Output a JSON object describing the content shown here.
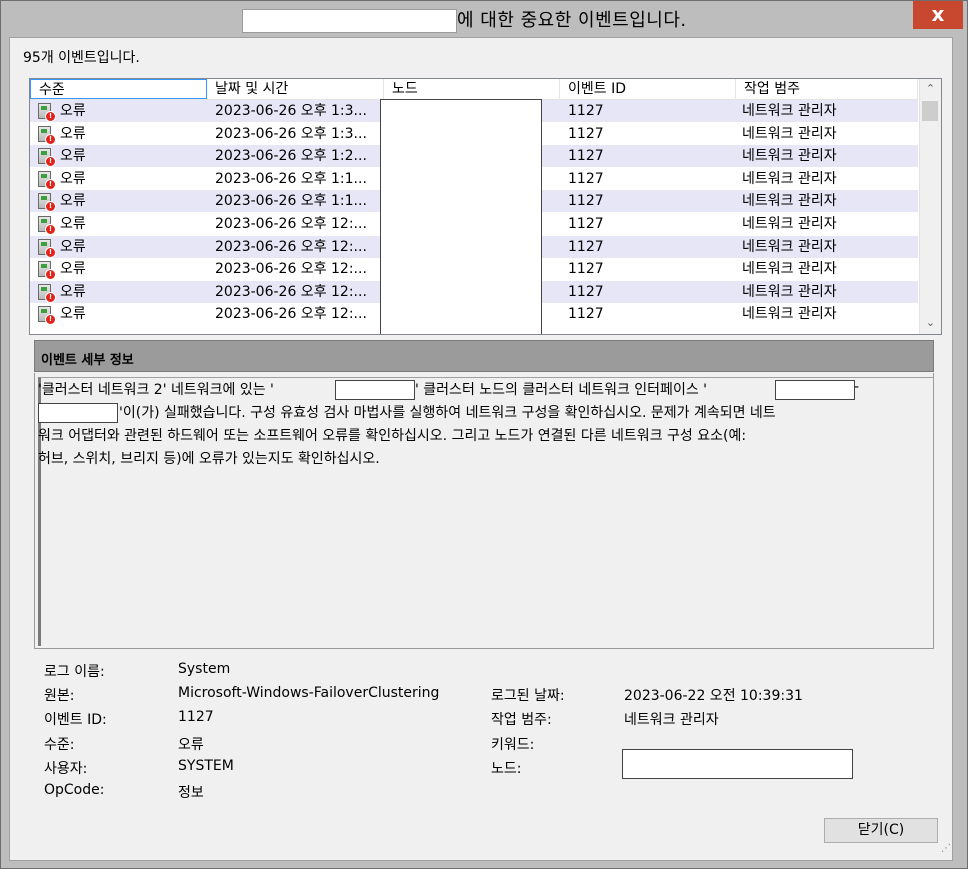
{
  "window": {
    "title_suffix": "에 대한 중요한 이벤트입니다.",
    "close_glyph": "x"
  },
  "summary": {
    "count_text": "95개 이벤트입니다."
  },
  "list": {
    "columns": [
      "수준",
      "날짜 및 시간",
      "노드",
      "이벤트 ID",
      "작업 범주"
    ],
    "rows": [
      {
        "level": "오류",
        "datetime": "2023-06-26 오후 1:3...",
        "event_id": "1127",
        "category": "네트워크 관리자"
      },
      {
        "level": "오류",
        "datetime": "2023-06-26 오후 1:3...",
        "event_id": "1127",
        "category": "네트워크 관리자"
      },
      {
        "level": "오류",
        "datetime": "2023-06-26 오후 1:2...",
        "event_id": "1127",
        "category": "네트워크 관리자"
      },
      {
        "level": "오류",
        "datetime": "2023-06-26 오후 1:1...",
        "event_id": "1127",
        "category": "네트워크 관리자"
      },
      {
        "level": "오류",
        "datetime": "2023-06-26 오후 1:1...",
        "event_id": "1127",
        "category": "네트워크 관리자"
      },
      {
        "level": "오류",
        "datetime": "2023-06-26 오후 12:...",
        "event_id": "1127",
        "category": "네트워크 관리자"
      },
      {
        "level": "오류",
        "datetime": "2023-06-26 오후 12:...",
        "event_id": "1127",
        "category": "네트워크 관리자"
      },
      {
        "level": "오류",
        "datetime": "2023-06-26 오후 12:...",
        "event_id": "1127",
        "category": "네트워크 관리자"
      },
      {
        "level": "오류",
        "datetime": "2023-06-26 오후 12:...",
        "event_id": "1127",
        "category": "네트워크 관리자"
      },
      {
        "level": "오류",
        "datetime": "2023-06-26 오후 12:...",
        "event_id": "1127",
        "category": "네트워크 관리자"
      }
    ]
  },
  "details": {
    "header": "이벤트 세부 정보",
    "line1_a": "'클러스터 네트워크 2' 네트워크에 있는 '",
    "line1_b": "' 클러스터 노드의 클러스터 네트워크 인터페이스 '",
    "line1_c": " -",
    "line2_a": "'이(가) 실패했습니다. 구성 유효성 검사 마법사를 실행하여 네트워크 구성을 확인하십시오. 문제가 계속되면 네트",
    "line3": "워크 어댑터와 관련된 하드웨어 또는 소프트웨어 오류를 확인하십시오. 그리고 노드가 연결된 다른 네트워크 구성 요소(예:",
    "line4": "허브, 스위치, 브리지 등)에 오류가 있는지도 확인하십시오."
  },
  "properties": {
    "log_name_label": "로그 이름:",
    "log_name_value": "System",
    "source_label": "원본:",
    "source_value": "Microsoft-Windows-FailoverClustering",
    "event_id_label": "이벤트 ID:",
    "event_id_value": "1127",
    "level_label": "수준:",
    "level_value": "오류",
    "user_label": "사용자:",
    "user_value": "SYSTEM",
    "opcode_label": "OpCode:",
    "opcode_value": "정보",
    "logged_label": "로그된 날짜:",
    "logged_value": "2023-06-22 오전 10:39:31",
    "category_label": "작업 범주:",
    "category_value": "네트워크 관리자",
    "keywords_label": "키워드:",
    "node_label": "노드:"
  },
  "buttons": {
    "close_label": "닫기(C)"
  },
  "colors": {
    "close_button": "#c7472f",
    "alt_row": "#e6e6f7",
    "details_header": "#9b9b9b"
  },
  "icons": {
    "level": "error-event-icon",
    "scroll_up": "chevron-up-icon",
    "scroll_down": "chevron-down-icon"
  }
}
